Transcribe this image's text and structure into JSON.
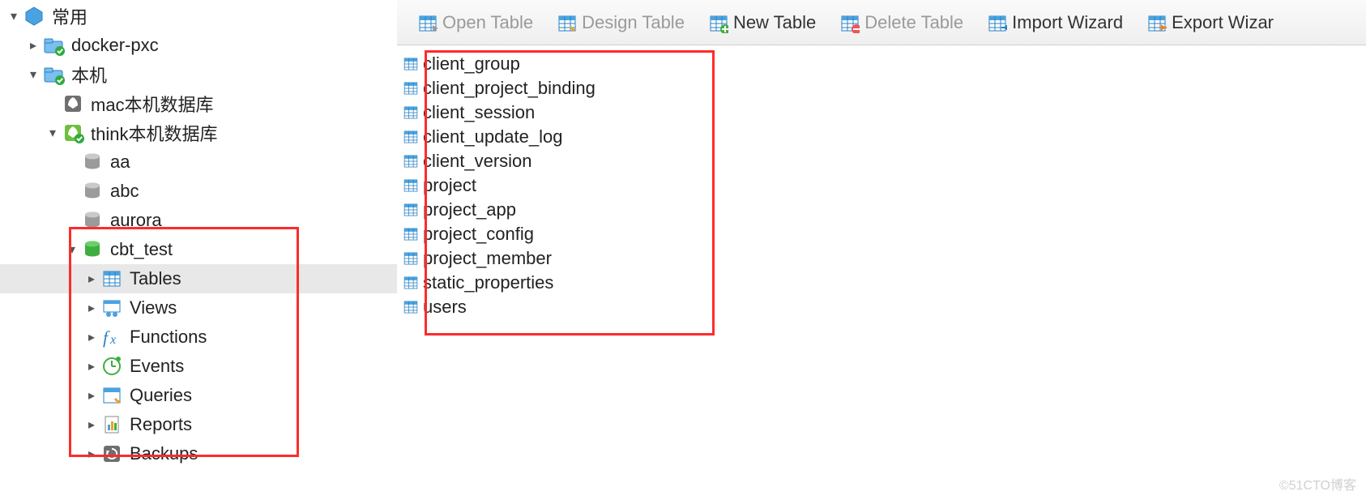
{
  "sidebar": {
    "items": [
      {
        "name": "group-frequent",
        "label": "常用",
        "caret": "open",
        "icon": "hexagon",
        "indent": 0,
        "selected": false
      },
      {
        "name": "conn-docker-pxc",
        "label": "docker-pxc",
        "caret": "closed",
        "icon": "folder-link",
        "indent": 1,
        "selected": false
      },
      {
        "name": "conn-local",
        "label": "本机",
        "caret": "open",
        "icon": "folder-link",
        "indent": 1,
        "selected": false
      },
      {
        "name": "db-mac-local",
        "label": "mac本机数据库",
        "caret": "none",
        "icon": "rocket",
        "indent": 2,
        "selected": false
      },
      {
        "name": "db-think-local",
        "label": "think本机数据库",
        "caret": "open",
        "icon": "rocket-green",
        "indent": 2,
        "selected": false
      },
      {
        "name": "schema-aa",
        "label": "aa",
        "caret": "none",
        "icon": "db-grey",
        "indent": 3,
        "selected": false
      },
      {
        "name": "schema-abc",
        "label": "abc",
        "caret": "none",
        "icon": "db-grey",
        "indent": 3,
        "selected": false
      },
      {
        "name": "schema-aurora",
        "label": "aurora",
        "caret": "none",
        "icon": "db-grey",
        "indent": 3,
        "selected": false
      },
      {
        "name": "schema-cbt-test",
        "label": "cbt_test",
        "caret": "open",
        "icon": "db-green",
        "indent": 3,
        "selected": false
      },
      {
        "name": "node-tables",
        "label": "Tables",
        "caret": "closed",
        "icon": "table-blue",
        "indent": 4,
        "selected": true
      },
      {
        "name": "node-views",
        "label": "Views",
        "caret": "closed",
        "icon": "views",
        "indent": 4,
        "selected": false
      },
      {
        "name": "node-functions",
        "label": "Functions",
        "caret": "closed",
        "icon": "fx",
        "indent": 4,
        "selected": false
      },
      {
        "name": "node-events",
        "label": "Events",
        "caret": "closed",
        "icon": "clock",
        "indent": 4,
        "selected": false
      },
      {
        "name": "node-queries",
        "label": "Queries",
        "caret": "closed",
        "icon": "query",
        "indent": 4,
        "selected": false
      },
      {
        "name": "node-reports",
        "label": "Reports",
        "caret": "closed",
        "icon": "report",
        "indent": 4,
        "selected": false
      },
      {
        "name": "node-backups",
        "label": "Backups",
        "caret": "closed",
        "icon": "backup",
        "indent": 4,
        "selected": false
      }
    ]
  },
  "toolbar": {
    "items": [
      {
        "name": "open-table",
        "label": "Open Table",
        "icon": "t-open",
        "disabled": true
      },
      {
        "name": "design-table",
        "label": "Design Table",
        "icon": "t-design",
        "disabled": true
      },
      {
        "name": "new-table",
        "label": "New Table",
        "icon": "t-new",
        "disabled": false
      },
      {
        "name": "delete-table",
        "label": "Delete Table",
        "icon": "t-delete",
        "disabled": true
      },
      {
        "name": "import-wizard",
        "label": "Import Wizard",
        "icon": "t-import",
        "disabled": false
      },
      {
        "name": "export-wizard",
        "label": "Export Wizar",
        "icon": "t-export",
        "disabled": false
      }
    ]
  },
  "tables": [
    "client_group",
    "client_project_binding",
    "client_session",
    "client_update_log",
    "client_version",
    "project",
    "project_app",
    "project_config",
    "project_member",
    "static_properties",
    "users"
  ],
  "watermark": "©51CTO博客"
}
